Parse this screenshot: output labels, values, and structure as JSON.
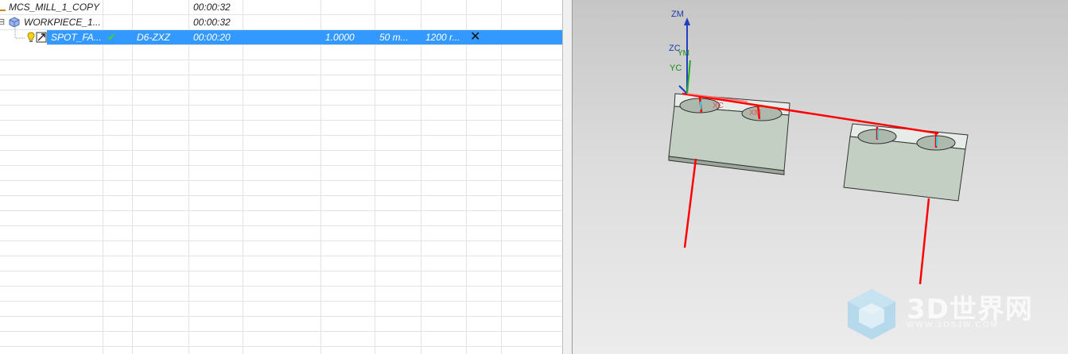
{
  "navigator": {
    "rows": [
      {
        "name": "MCS_MILL_1_COPY",
        "path": "",
        "tool": "",
        "time": "00:00:32",
        "c5": "",
        "c6": "",
        "c7": "",
        "c8": ""
      },
      {
        "name": "WORKPIECE_1...",
        "path": "",
        "tool": "",
        "time": "00:00:32",
        "c5": "",
        "c6": "",
        "c7": "",
        "c8": ""
      },
      {
        "name": "SPOT_FA...",
        "path": "✔",
        "tool": "D6-ZXZ",
        "time": "00:00:20",
        "c5": "1.0000",
        "c6": "50 m...",
        "c7": "1200 r...",
        "c8": "✕"
      }
    ],
    "expand_symbol": "⊟"
  },
  "viewport": {
    "axis_labels": {
      "zm": "ZM",
      "zc": "ZC",
      "yc": "YC",
      "ym": "YM",
      "xc": "XC",
      "xm": "XM"
    },
    "watermark": {
      "title": "3D世界网",
      "url": "WWW.3DSJW.COM"
    },
    "colors": {
      "selection": "#3399ff",
      "toolpath": "#ff0000",
      "block": "#c3cfc3"
    }
  }
}
